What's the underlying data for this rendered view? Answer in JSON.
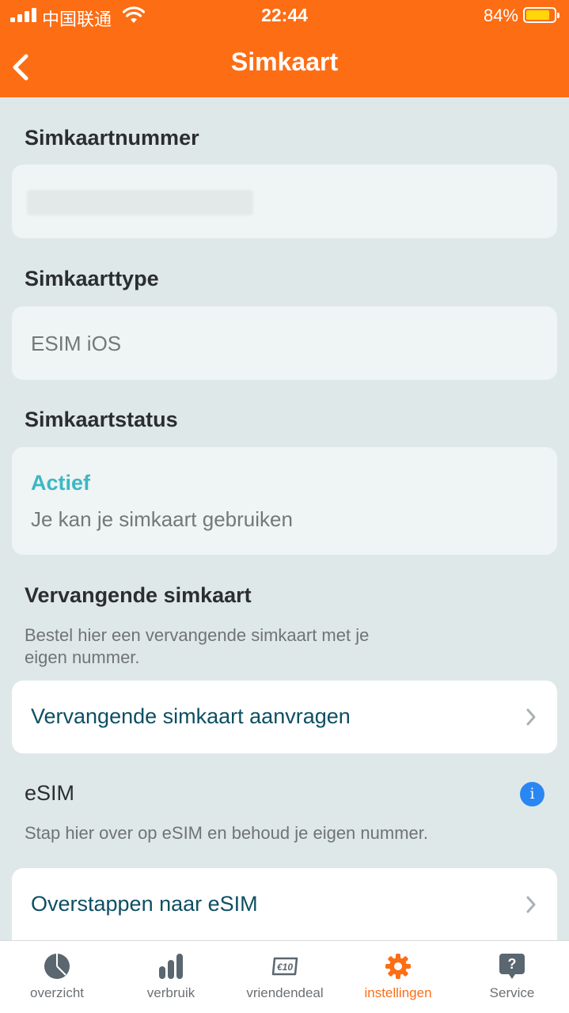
{
  "status_bar": {
    "carrier": "中国联通",
    "time": "22:44",
    "battery_percent": "84%",
    "battery_level": 0.84
  },
  "header": {
    "title": "Simkaart",
    "back_icon": "chevron-left-icon"
  },
  "sections": {
    "simnumber": {
      "label": "Simkaartnummer",
      "value": ""
    },
    "simtype": {
      "label": "Simkaarttype",
      "value": "ESIM iOS"
    },
    "simstatus": {
      "label": "Simkaartstatus",
      "status": "Actief",
      "description": "Je kan je simkaart gebruiken"
    },
    "replacement": {
      "label": "Vervangende simkaart",
      "description_line1": "Bestel hier een vervangende simkaart met je",
      "description_line2": "eigen nummer.",
      "action": "Vervangende simkaart aanvragen"
    },
    "esim": {
      "label": "eSIM",
      "description": "Stap hier over op eSIM en behoud je eigen nummer.",
      "action": "Overstappen naar eSIM",
      "info_icon": "info-icon",
      "info_glyph": "i"
    }
  },
  "bottom_nav": {
    "items": [
      {
        "label": "overzicht",
        "icon": "pie-chart-icon"
      },
      {
        "label": "verbruik",
        "icon": "bar-chart-icon"
      },
      {
        "label": "vriendendeal",
        "icon": "ticket-icon",
        "badge_text": "€10"
      },
      {
        "label": "instellingen",
        "icon": "gear-icon",
        "active": true
      },
      {
        "label": "Service",
        "icon": "help-bubble-icon",
        "badge_text": "?"
      }
    ]
  },
  "colors": {
    "brand_orange": "#fd6d14",
    "background": "#dfe8e8",
    "active_status": "#3bb8c4",
    "link_text": "#0d4f63",
    "info_blue": "#2a86f2"
  }
}
